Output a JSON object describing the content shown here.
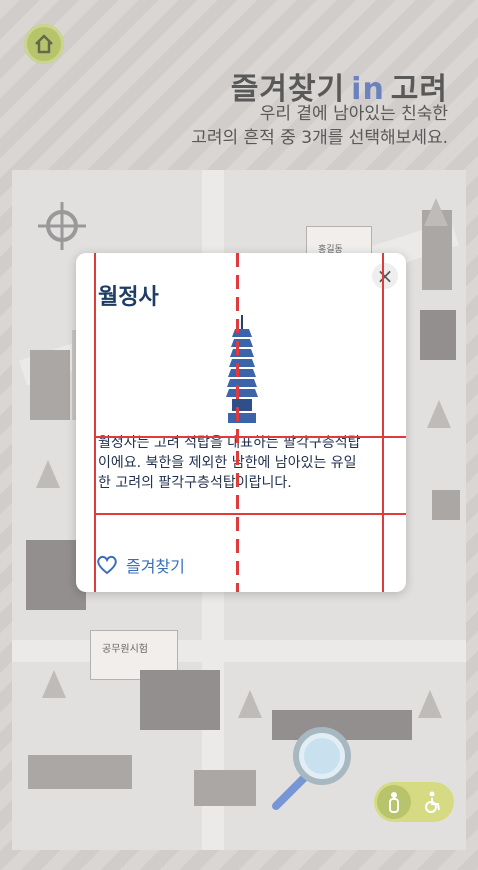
{
  "header": {
    "title_prefix": "즐겨찾기",
    "title_accent": "in",
    "title_suffix": "고려",
    "subtitle_line1": "우리 곁에 남아있는 친숙한",
    "subtitle_line2": "고려의 흔적 중 3개를 선택해보세요."
  },
  "map_labels": {
    "exam_sign": "공무원시험",
    "id_card_name": "홍길동"
  },
  "modal": {
    "title": "월정사",
    "description": "월정사는 고려 석탑을 대표하는 팔각구층석탑이에요. 북한을 제외한 남한에 남아있는 유일한 고려의 팔각구층석탑이랍니다.",
    "favorite_label": "즐겨찾기",
    "close_symbol": "×"
  },
  "colors": {
    "accent": "#3a58a8",
    "home_green": "#9fb13a",
    "modal_title": "#1e3c64",
    "guide_red": "#e03a3a"
  },
  "icons": [
    "home-icon",
    "close-icon",
    "heart-icon",
    "magnifier-icon",
    "person-icon",
    "wheelchair-icon",
    "pagoda-icon"
  ]
}
